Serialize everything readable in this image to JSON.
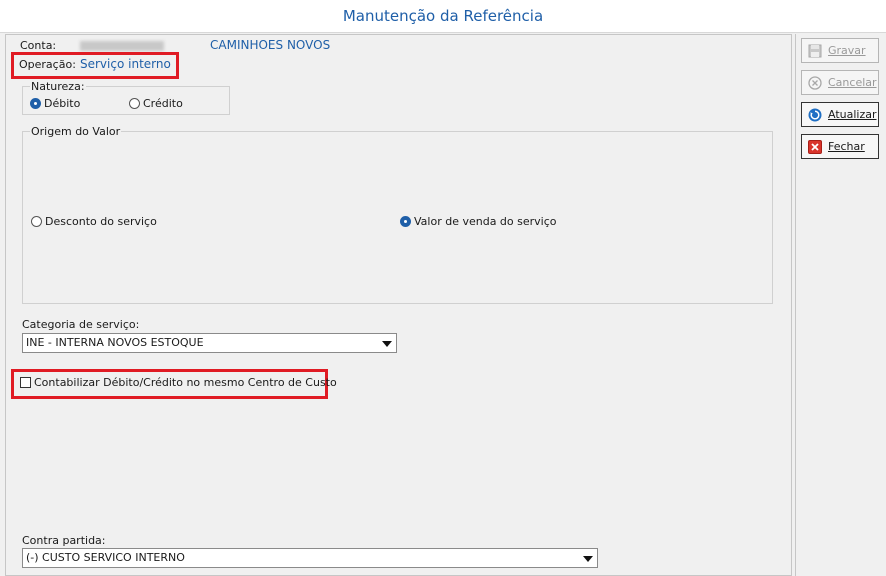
{
  "window": {
    "title": "Manutenção da Referência"
  },
  "header": {
    "conta_label": "Conta:",
    "conta_name": "CAMINHOES NOVOS",
    "operacao_label": "Operação:",
    "operacao_value": "Serviço interno"
  },
  "natureza": {
    "label": "Natureza:",
    "options": [
      "Débito",
      "Crédito"
    ],
    "selected": "Débito"
  },
  "origem": {
    "label": "Origem do Valor",
    "options": [
      "Desconto do serviço",
      "Valor de venda do serviço"
    ],
    "selected": "Valor de venda do serviço"
  },
  "categoria": {
    "label": "Categoria de serviço:",
    "value": "INE - INTERNA NOVOS ESTOQUE"
  },
  "contabilizar": {
    "label": "Contabilizar Débito/Crédito no mesmo Centro de Custo",
    "checked": false
  },
  "contra_partida": {
    "label": "Contra partida:",
    "value": "(-) CUSTO SERVICO INTERNO"
  },
  "buttons": {
    "gravar": {
      "label": "Gravar",
      "enabled": false
    },
    "cancelar": {
      "label": "Cancelar",
      "enabled": false
    },
    "atualizar": {
      "label": "Atualizar",
      "enabled": true
    },
    "fechar": {
      "label": "Fechar",
      "enabled": true
    }
  },
  "colors": {
    "accent": "#1f5fa8",
    "highlight": "#e01b24",
    "close_icon": "#d9342b"
  }
}
